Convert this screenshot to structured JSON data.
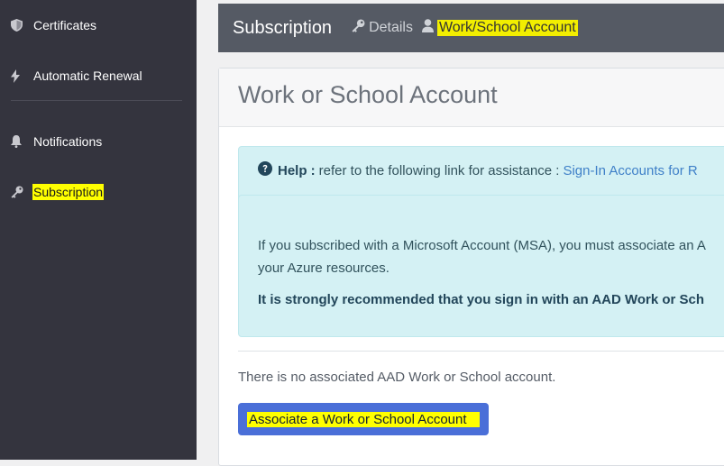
{
  "sidebar": {
    "items": [
      {
        "label": "Certificates",
        "icon": "shield-icon"
      },
      {
        "label": "Automatic Renewal",
        "icon": "lightning-icon"
      },
      {
        "label": "Notifications",
        "icon": "bell-icon"
      },
      {
        "label": "Subscription",
        "icon": "key-icon"
      }
    ]
  },
  "header": {
    "title": "Subscription",
    "crumbs": [
      {
        "label": "Details",
        "icon": "key-icon"
      },
      {
        "label": "Work/School Account",
        "icon": "user-icon"
      }
    ]
  },
  "card": {
    "title": "Work or School Account",
    "help": {
      "label": "Help :",
      "text": "refer to the following link for assistance :",
      "link": "Sign-In Accounts for R"
    },
    "info": {
      "line1": "If you subscribed with a Microsoft Account (MSA), you must associate an A",
      "line2": "your Azure resources.",
      "strong": "It is strongly recommended that you sign in with an AAD Work or Sch"
    },
    "status": "There is no associated AAD Work or School account.",
    "button_label": "Associate a Work or School Account"
  },
  "colors": {
    "sidebar_bg": "#34343e",
    "topbar_bg": "#555a64",
    "alert_bg": "#d4f1f4",
    "button_bg": "#4a6fd8",
    "highlight": "#ffff00"
  }
}
